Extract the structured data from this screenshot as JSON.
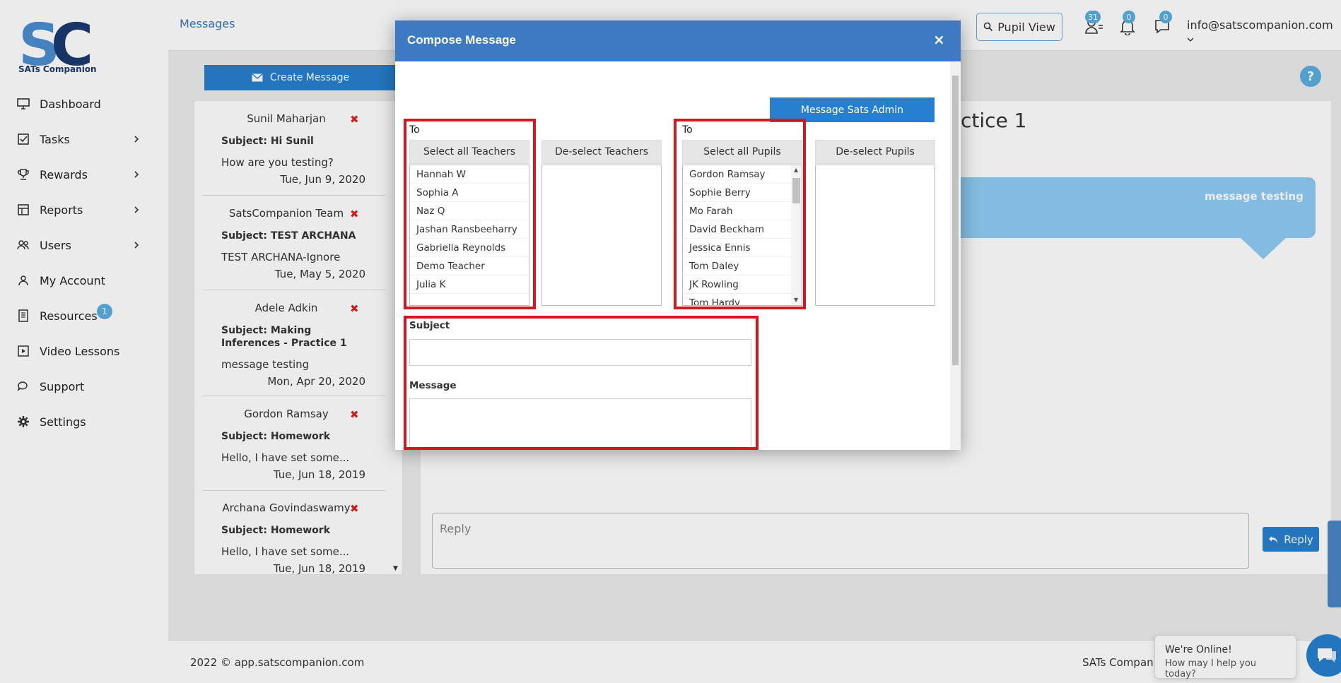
{
  "app": {
    "logo_text": "SATs Companion",
    "logo_mark": "SC"
  },
  "sidebar": {
    "items": [
      {
        "label": "Dashboard",
        "icon": "monitor-icon",
        "has_children": false
      },
      {
        "label": "Tasks",
        "icon": "tasks-icon",
        "has_children": true
      },
      {
        "label": "Rewards",
        "icon": "trophy-icon",
        "has_children": true
      },
      {
        "label": "Reports",
        "icon": "reports-icon",
        "has_children": true
      },
      {
        "label": "Users",
        "icon": "users-icon",
        "has_children": true
      },
      {
        "label": "My Account",
        "icon": "account-icon",
        "has_children": false
      },
      {
        "label": "Resources",
        "icon": "resources-icon",
        "has_children": false,
        "badge": "1"
      },
      {
        "label": "Video Lessons",
        "icon": "video-icon",
        "has_children": false
      },
      {
        "label": "Support",
        "icon": "support-icon",
        "has_children": false
      },
      {
        "label": "Settings",
        "icon": "gear-icon",
        "has_children": false
      }
    ]
  },
  "topbar": {
    "breadcrumb": "Messages",
    "pupil_view_label": "Pupil View",
    "users_badge": "31",
    "notifications_badge": "0",
    "messages_badge": "0",
    "user_email": "info@satscompanion.com"
  },
  "main": {
    "create_message_label": "Create Message",
    "help_label": "?",
    "inbox": [
      {
        "sender": "Sunil Maharjan",
        "subject": "Subject: Hi Sunil",
        "preview": "How are you testing?",
        "date": "Tue, Jun 9, 2020"
      },
      {
        "sender": "SatsCompanion Team",
        "subject": "Subject: TEST ARCHANA",
        "preview": "TEST ARCHANA-Ignore",
        "date": "Tue, May 5, 2020"
      },
      {
        "sender": "Adele Adkin",
        "subject": "Subject: Making Inferences - Practice 1",
        "preview": "message testing",
        "date": "Mon, Apr 20, 2020"
      },
      {
        "sender": "Gordon Ramsay",
        "subject": "Subject: Homework",
        "preview": "Hello, I have set some...",
        "date": "Tue, Jun 18, 2019"
      },
      {
        "sender": "Archana Govindaswamy",
        "subject": "Subject: Homework",
        "preview": "Hello, I have set some...",
        "date": "Tue, Jun 18, 2019"
      }
    ],
    "detail_title": "ctice 1",
    "bubble_text": "message testing",
    "reply_placeholder": "Reply",
    "reply_label": "Reply"
  },
  "modal": {
    "title": "Compose Message",
    "close": "×",
    "message_admin_label": "Message Sats Admin",
    "teachers": {
      "to_label": "To",
      "select_all_label": "Select all Teachers",
      "deselect_label": "De-select Teachers",
      "items": [
        "Hannah W",
        "Sophia A",
        "Naz Q",
        "Jashan Ransbeeharry",
        "Gabriella Reynolds",
        "Demo Teacher",
        "Julia K"
      ]
    },
    "pupils": {
      "to_label": "To",
      "select_all_label": "Select all Pupils",
      "deselect_label": "De-select Pupils",
      "items": [
        "Gordon Ramsay",
        "Sophie Berry",
        "Mo Farah",
        "David Beckham",
        "Jessica Ennis",
        "Tom Daley",
        "JK Rowling",
        "Tom Hardy"
      ]
    },
    "subject_label": "Subject",
    "message_label": "Message"
  },
  "footer": {
    "copyright": "2022 © app.satscompanion.com",
    "right_text": "SATs Compan"
  },
  "chat": {
    "title": "We're Online!",
    "subtitle": "How may I help you today?"
  },
  "colors": {
    "primary": "#2680cf",
    "modal_header": "#3d7ac3",
    "badge": "#5aaee0",
    "highlight_red": "#d2171e",
    "bubble": "#8fcdf3"
  }
}
